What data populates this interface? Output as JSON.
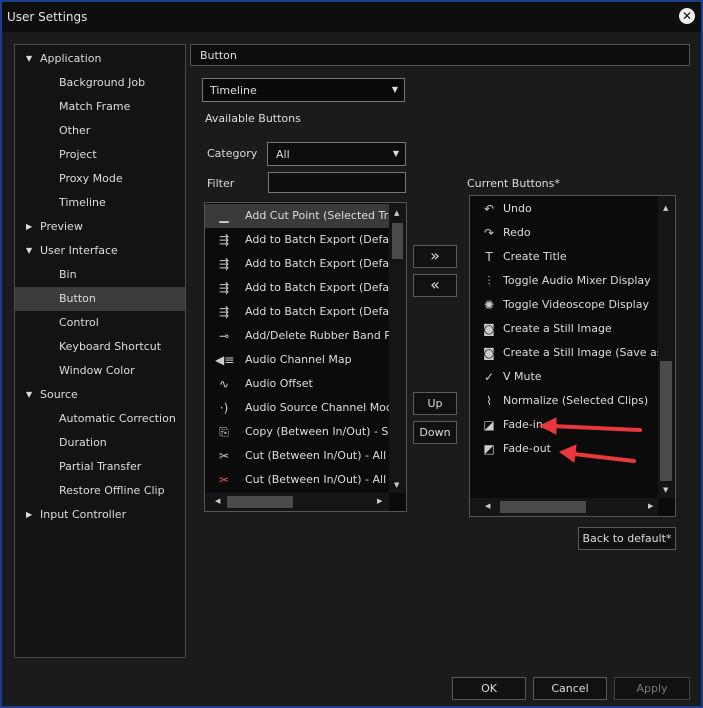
{
  "window": {
    "title": "User Settings",
    "close_icon": "close-circle-icon"
  },
  "tree": [
    {
      "label": "Application",
      "level": 0,
      "expanded": true
    },
    {
      "label": "Background Job",
      "level": 1
    },
    {
      "label": "Match Frame",
      "level": 1
    },
    {
      "label": "Other",
      "level": 1
    },
    {
      "label": "Project",
      "level": 1
    },
    {
      "label": "Proxy Mode",
      "level": 1
    },
    {
      "label": "Timeline",
      "level": 1
    },
    {
      "label": "Preview",
      "level": 0,
      "expanded": false
    },
    {
      "label": "User Interface",
      "level": 0,
      "expanded": true
    },
    {
      "label": "Bin",
      "level": 1
    },
    {
      "label": "Button",
      "level": 1,
      "selected": true
    },
    {
      "label": "Control",
      "level": 1
    },
    {
      "label": "Keyboard Shortcut",
      "level": 1
    },
    {
      "label": "Window Color",
      "level": 1
    },
    {
      "label": "Source",
      "level": 0,
      "expanded": true
    },
    {
      "label": "Automatic Correction",
      "level": 1
    },
    {
      "label": "Duration",
      "level": 1
    },
    {
      "label": "Partial Transfer",
      "level": 1
    },
    {
      "label": "Restore Offline Clip",
      "level": 1
    },
    {
      "label": "Input Controller",
      "level": 0,
      "expanded": false
    }
  ],
  "section_title": "Button",
  "context_select": "Timeline",
  "available_label": "Available Buttons",
  "category_label": "Category",
  "category_value": "All",
  "filter_label": "Filter",
  "filter_value": "",
  "current_label": "Current Buttons*",
  "available": [
    {
      "label": "Add Cut Point (Selected Track",
      "icon": "cut-point-icon",
      "selected": true
    },
    {
      "label": "Add to Batch Export (Default",
      "icon": "batch-export-1-icon"
    },
    {
      "label": "Add to Batch Export (Default",
      "icon": "batch-export-2-icon"
    },
    {
      "label": "Add to Batch Export (Default",
      "icon": "batch-export-3-icon"
    },
    {
      "label": "Add to Batch Export (Default",
      "icon": "batch-export-4-icon"
    },
    {
      "label": "Add/Delete Rubber Band Poin",
      "icon": "rubber-band-icon"
    },
    {
      "label": "Audio Channel Map",
      "icon": "audio-channel-map-icon"
    },
    {
      "label": "Audio Offset",
      "icon": "audio-offset-icon"
    },
    {
      "label": "Audio Source Channel Mode (",
      "icon": "audio-source-icon"
    },
    {
      "label": "Copy (Between In/Out) - Sele",
      "icon": "copy-icon"
    },
    {
      "label": "Cut (Between In/Out) - All Tra",
      "icon": "cut-icon"
    },
    {
      "label": "Cut (Between In/Out) - All Tra",
      "icon": "cut-red-icon"
    }
  ],
  "current": [
    {
      "label": "Undo",
      "icon": "undo-icon"
    },
    {
      "label": "Redo",
      "icon": "redo-icon"
    },
    {
      "label": "Create Title",
      "icon": "title-icon"
    },
    {
      "label": "Toggle Audio Mixer Display",
      "icon": "audio-mixer-icon"
    },
    {
      "label": "Toggle Videoscope Display",
      "icon": "videoscope-icon"
    },
    {
      "label": "Create a Still Image",
      "icon": "camera-icon"
    },
    {
      "label": "Create a Still Image (Save as)",
      "icon": "camera-save-icon"
    },
    {
      "label": "V Mute",
      "icon": "v-mute-icon"
    },
    {
      "label": "Normalize (Selected Clips)",
      "icon": "normalize-icon"
    },
    {
      "label": "Fade-in",
      "icon": "fade-in-icon"
    },
    {
      "label": "Fade-out",
      "icon": "fade-out-icon"
    }
  ],
  "buttons": {
    "add": "»",
    "remove": "«",
    "up": "Up",
    "down": "Down",
    "back_default": "Back to default*",
    "ok": "OK",
    "cancel": "Cancel",
    "apply": "Apply"
  },
  "annotation_color": "#e8383d"
}
